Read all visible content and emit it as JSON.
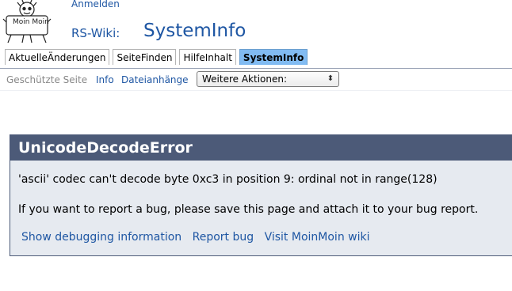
{
  "header": {
    "logo_text": "Moin Moin",
    "login_label": "Anmelden",
    "wiki_name": "RS-Wiki:",
    "page_title": "SystemInfo"
  },
  "tabs": [
    {
      "label": "AktuelleÄnderungen",
      "active": false
    },
    {
      "label": "SeiteFinden",
      "active": false
    },
    {
      "label": "HilfeInhalt",
      "active": false
    },
    {
      "label": "SystemInfo",
      "active": true
    }
  ],
  "actions": {
    "protected_label": "Geschützte Seite",
    "info_label": "Info",
    "attachments_label": "Dateianhänge",
    "more_actions_selected": "Weitere Aktionen:"
  },
  "error": {
    "title": "UnicodeDecodeError",
    "message": "'ascii' codec can't decode byte 0xc3 in position 9: ordinal not in range(128)",
    "report_note": "If you want to report a bug, please save this page and attach it to your bug report.",
    "links": [
      "Show debugging information",
      "Report bug",
      "Visit MoinMoin wiki"
    ]
  },
  "colors": {
    "link": "#1e56a3",
    "active_tab": "#81bbf2",
    "error_header": "#4c5a78",
    "error_body": "#e6eaf0"
  }
}
